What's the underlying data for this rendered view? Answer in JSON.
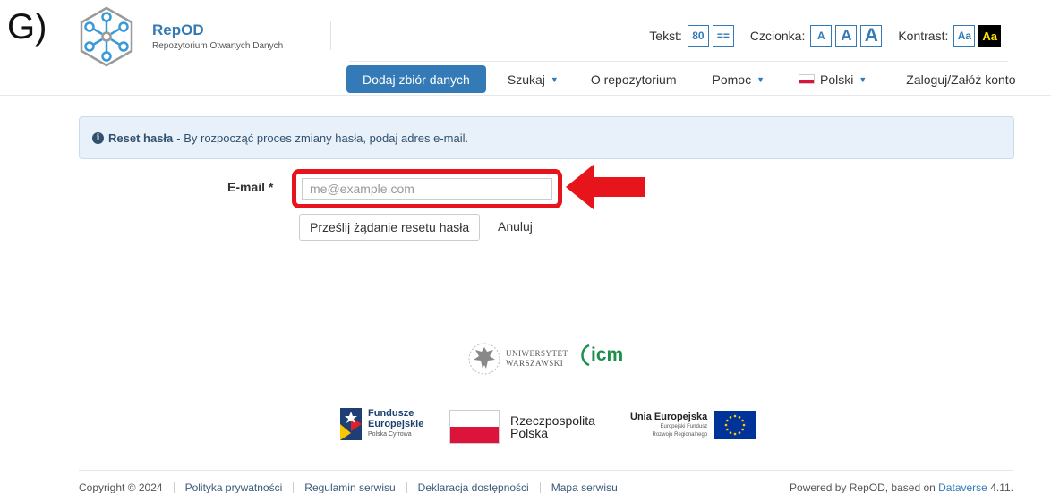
{
  "panel_label": "G)",
  "brand": {
    "name": "RepOD",
    "subtitle": "Repozytorium Otwartych Danych",
    "colors": {
      "primary": "#337ab7",
      "nav_bg": "#337ab7"
    }
  },
  "accessibility": {
    "text_label": "Tekst:",
    "text_size": "80",
    "text_spacing": "==",
    "font_label": "Czcionka:",
    "font_small": "A",
    "font_mid": "A",
    "font_big": "A",
    "contrast_label": "Kontrast:",
    "contrast_normal": "Aa",
    "contrast_high": "Aa"
  },
  "nav": {
    "add_dataset": "Dodaj zbiór danych",
    "search": "Szukaj",
    "about": "O repozytorium",
    "help": "Pomoc",
    "language": "Polski",
    "login": "Zaloguj/Załóż konto"
  },
  "alert": {
    "title": "Reset hasła",
    "message": "- By rozpocząć proces zmiany hasła, podaj adres e-mail.",
    "icon": "info-icon"
  },
  "form": {
    "email_label": "E-mail *",
    "email_value": "",
    "email_placeholder": "me@example.com",
    "submit_label": "Prześlij żądanie resetu hasła",
    "cancel_label": "Anuluj",
    "highlight_color": "#e8141b"
  },
  "partners": {
    "uw_line1": "UNIWERSYTET",
    "uw_line2": "WARSZAWSKI",
    "icm": "icm",
    "fe_line1": "Fundusze",
    "fe_line2": "Europejskie",
    "fe_line3": "Polska Cyfrowa",
    "rp_line1": "Rzeczpospolita",
    "rp_line2": "Polska",
    "ue_line1": "Unia Europejska",
    "ue_line2": "Europejski Fundusz",
    "ue_line3": "Rozwoju Regionalnego"
  },
  "footer": {
    "copyright": "Copyright © 2024",
    "privacy": "Polityka prywatności",
    "terms": "Regulamin serwisu",
    "accessibility": "Deklaracja dostępności",
    "sitemap": "Mapa serwisu",
    "powered_prefix": "Powered by RepOD, based on",
    "powered_link": "Dataverse",
    "powered_version": "4.11."
  }
}
